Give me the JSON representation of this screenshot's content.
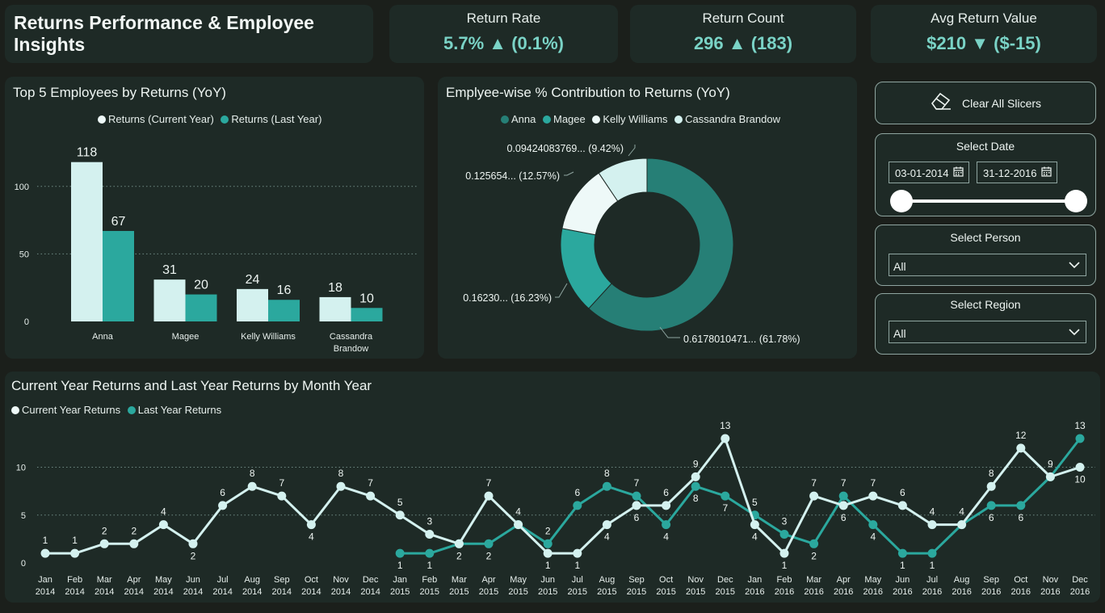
{
  "header": {
    "title": "Returns Performance & Employee Insights"
  },
  "kpis": [
    {
      "label": "Return Rate",
      "value": "5.7%",
      "arrow": "▲",
      "delta": "(0.1%)"
    },
    {
      "label": "Return Count",
      "value": "296",
      "arrow": "▲",
      "delta": "(183)"
    },
    {
      "label": "Avg Return Value",
      "value": "$210",
      "arrow": "▼",
      "delta": "($-15)"
    }
  ],
  "bar_card": {
    "title": "Top 5 Employees by Returns (YoY)",
    "legend": [
      "Returns (Current Year)",
      "Returns (Last Year)"
    ]
  },
  "donut_card": {
    "title": "Emplyee-wise % Contribution to Returns (YoY)",
    "legend": [
      "Anna",
      "Magee",
      "Kelly Williams",
      "Cassandra Brandow"
    ]
  },
  "line_card": {
    "title": "Current Year Returns and Last Year Returns by Month Year",
    "legend": [
      "Current Year Returns",
      "Last Year Returns"
    ]
  },
  "slicers": {
    "clear_label": "Clear All Slicers",
    "date_title": "Select Date",
    "date_start": "03-01-2014",
    "date_end": "31-12-2016",
    "person_title": "Select Person",
    "person_value": "All",
    "region_title": "Select Region",
    "region_value": "All"
  },
  "colors": {
    "current": "#d4f1ef",
    "last": "#2ba89e",
    "anna": "#267f76",
    "magee": "#2ba89e",
    "kelly": "#eef9f8",
    "cassandra": "#d4f1ef"
  },
  "chart_data": [
    {
      "type": "bar",
      "title": "Top 5 Employees by Returns (YoY)",
      "categories": [
        "Anna",
        "Magee",
        "Kelly Williams",
        "Cassandra Brandow"
      ],
      "series": [
        {
          "name": "Returns (Current Year)",
          "values": [
            118,
            31,
            24,
            18
          ]
        },
        {
          "name": "Returns (Last Year)",
          "values": [
            67,
            20,
            16,
            10
          ]
        }
      ],
      "yticks": [
        "0",
        "50",
        "100"
      ],
      "ylim": [
        0,
        125
      ],
      "grid": true,
      "legend": "top-center"
    },
    {
      "type": "pie",
      "title": "Emplyee-wise % Contribution to Returns (YoY)",
      "labels": [
        "Anna",
        "Magee",
        "Kelly Williams",
        "Cassandra Brandow"
      ],
      "values": [
        61.78,
        16.23,
        12.57,
        9.42
      ],
      "data_labels": [
        "0.6178010471... (61.78%)",
        "0.16230... (16.23%)",
        "0.125654... (12.57%)",
        "0.09424083769... (9.42%)"
      ],
      "legend": "top-center"
    },
    {
      "type": "line",
      "title": "Current Year Returns and Last Year Returns by Month Year",
      "x": [
        "Jan 2014",
        "Feb 2014",
        "Mar 2014",
        "Apr 2014",
        "May 2014",
        "Jun 2014",
        "Jul 2014",
        "Aug 2014",
        "Sep 2014",
        "Oct 2014",
        "Nov 2014",
        "Dec 2014",
        "Jan 2015",
        "Feb 2015",
        "Mar 2015",
        "Apr 2015",
        "May 2015",
        "Jun 2015",
        "Jul 2015",
        "Aug 2015",
        "Sep 2015",
        "Oct 2015",
        "Nov 2015",
        "Dec 2015",
        "Jan 2016",
        "Feb 2016",
        "Mar 2016",
        "Apr 2016",
        "May 2016",
        "Jun 2016",
        "Jul 2016",
        "Aug 2016",
        "Sep 2016",
        "Oct 2016",
        "Nov 2016",
        "Dec 2016"
      ],
      "series": [
        {
          "name": "Current Year Returns",
          "values": [
            1,
            1,
            2,
            2,
            4,
            2,
            6,
            8,
            7,
            4,
            8,
            7,
            5,
            3,
            2,
            7,
            4,
            1,
            1,
            4,
            6,
            6,
            9,
            13,
            4,
            1,
            7,
            6,
            7,
            6,
            4,
            4,
            8,
            12,
            9,
            10
          ]
        },
        {
          "name": "Last Year Returns",
          "values": [
            null,
            null,
            null,
            null,
            null,
            null,
            null,
            null,
            null,
            null,
            null,
            null,
            1,
            1,
            2,
            2,
            4,
            2,
            6,
            8,
            7,
            4,
            8,
            7,
            5,
            3,
            2,
            7,
            4,
            1,
            1,
            4,
            6,
            6,
            9,
            13
          ]
        }
      ],
      "yticks": [
        "0",
        "5",
        "10"
      ],
      "ylim": [
        0,
        13
      ],
      "grid": true,
      "legend": "top-left"
    }
  ]
}
